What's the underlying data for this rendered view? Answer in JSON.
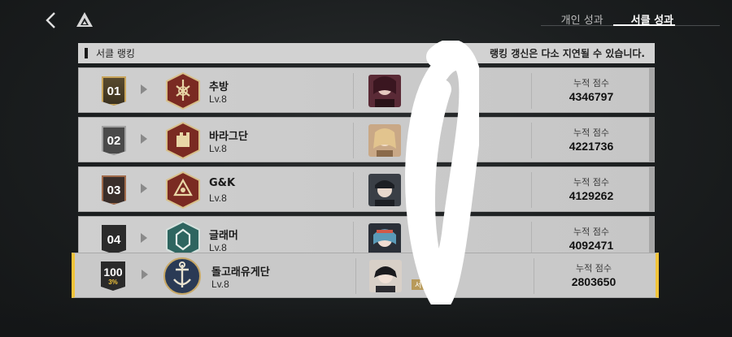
{
  "header": {
    "tabs": [
      {
        "label": "개인 성과",
        "active": false
      },
      {
        "label": "서클 성과",
        "active": true
      }
    ]
  },
  "section": {
    "title": "서클 랭킹",
    "note": "랭킹 갱신은 다소 지연될 수 있습니다."
  },
  "rows": [
    {
      "rank": "01",
      "name": "추방",
      "level": "Lv.8",
      "score_label": "누적 점수",
      "score": "4346797",
      "emblem_color": "#7a2a22",
      "leader_color": "#6a2a3a"
    },
    {
      "rank": "02",
      "name": "바라그단",
      "level": "Lv.8",
      "score_label": "누적 점수",
      "score": "4221736",
      "emblem_color": "#7a2a22",
      "leader_color": "#c9a886"
    },
    {
      "rank": "03",
      "name": "G&K",
      "level": "Lv.8",
      "score_label": "누적 점수",
      "score": "4129262",
      "emblem_color": "#7a2a22",
      "leader_color": "#3a3f46"
    },
    {
      "rank": "04",
      "name": "글래머",
      "level": "Lv.8",
      "score_label": "누적 점수",
      "score": "4092471",
      "emblem_color": "#2e6560",
      "leader_color": "#5a9ab8"
    }
  ],
  "my_row": {
    "rank": "100",
    "percent": "3%",
    "name": "돌고래유게단",
    "level": "Lv.8",
    "role": "서",
    "score_label": "누적 점수",
    "score": "2803650",
    "emblem_color": "#2a3a55",
    "leader_color": "#2b2b30"
  },
  "colors": {
    "accent": "#f1c43a",
    "row_bg": "#cfcfcf",
    "background": "#1b1e1f"
  },
  "icons": {
    "back": "chevron-left-icon",
    "logo": "triangle-logo-icon",
    "rank_arrow": "play-arrow-icon"
  }
}
